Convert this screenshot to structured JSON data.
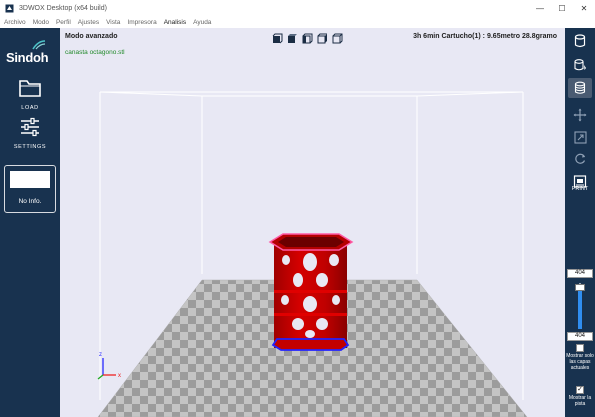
{
  "window": {
    "title": "3DWOX Desktop (x64 build)",
    "controls": [
      "—",
      "☐",
      "✕"
    ]
  },
  "menu": {
    "items": [
      "Archivo",
      "Modo",
      "Perfil",
      "Ajustes",
      "Vista",
      "Impresora",
      "Analisis",
      "Ayuda"
    ],
    "active": "Analisis"
  },
  "left": {
    "logo": "Sindoh",
    "load_label": "LOAD",
    "settings_label": "SETTINGS",
    "card_text": "No Info."
  },
  "viewport": {
    "mode": "Modo avanzado",
    "filename": "canasta octagono.stl",
    "print_info": "3h 6min  Cartucho(1) : 9.65metro 28.8gramo",
    "axis_z": "z",
    "axis_x": "x"
  },
  "right": {
    "print_label": "PRINT",
    "layer_top": "404",
    "layer_bottom": "404",
    "slider_fraction": 1.0,
    "show_current_label": "Mostrar solo las capas actuales",
    "show_current_checked": false,
    "show_track_label": "Mostrar la pista",
    "show_track_checked": true
  },
  "colors": {
    "sidebar": "#18324f",
    "viewport_bg": "#e8e8f4",
    "model": "#cc0000",
    "filename_green": "#238a2c",
    "slider_blue": "#2f8df0"
  }
}
